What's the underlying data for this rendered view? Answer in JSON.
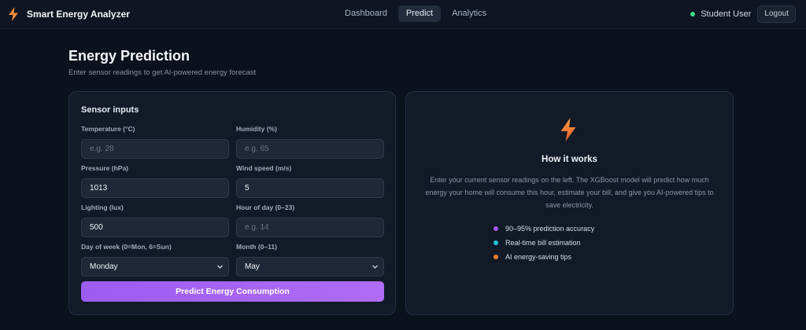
{
  "header": {
    "app_title": "Smart Energy Analyzer",
    "nav": [
      {
        "label": "Dashboard",
        "active": false
      },
      {
        "label": "Predict",
        "active": true
      },
      {
        "label": "Analytics",
        "active": false
      }
    ],
    "user_name": "Student User",
    "user_status_color": "#3ddc84",
    "logout_label": "Logout",
    "logo_icon": "lightning-bolt-icon"
  },
  "page": {
    "title": "Energy Prediction",
    "subtitle": "Enter sensor readings to get AI-powered energy forecast"
  },
  "sensor_inputs": {
    "title": "Sensor inputs",
    "temperature": {
      "label": "Temperature (°C)",
      "value": "",
      "placeholder": "e.g. 28"
    },
    "humidity": {
      "label": "Humidity (%)",
      "value": "",
      "placeholder": "e.g. 65"
    },
    "pressure": {
      "label": "Pressure (hPa)",
      "value": "1013",
      "placeholder": ""
    },
    "wind_speed": {
      "label": "Wind speed (m/s)",
      "value": "5",
      "placeholder": ""
    },
    "lighting": {
      "label": "Lighting (lux)",
      "value": "500",
      "placeholder": ""
    },
    "hour": {
      "label": "Hour of day (0–23)",
      "value": "",
      "placeholder": "e.g. 14"
    },
    "day_of_week": {
      "label": "Day of week (0=Mon, 6=Sun)",
      "selected": "Monday"
    },
    "month": {
      "label": "Month (0–11)",
      "selected": "May"
    },
    "submit_label": "Predict Energy Consumption",
    "accent_color": "#a564f4"
  },
  "how_it_works": {
    "icon": "lightning-bolt-icon",
    "title": "How it works",
    "description": "Enter your current sensor readings on the left. The XGBoost model will predict how much energy your home will consume this hour, estimate your bill, and give you AI-powered tips to save electricity.",
    "features": [
      {
        "text": "90–95% prediction accuracy",
        "color": "#a855f7"
      },
      {
        "text": "Real-time bill estimation",
        "color": "#22c3dc"
      },
      {
        "text": "AI energy-saving tips",
        "color": "#f07a22"
      }
    ]
  }
}
